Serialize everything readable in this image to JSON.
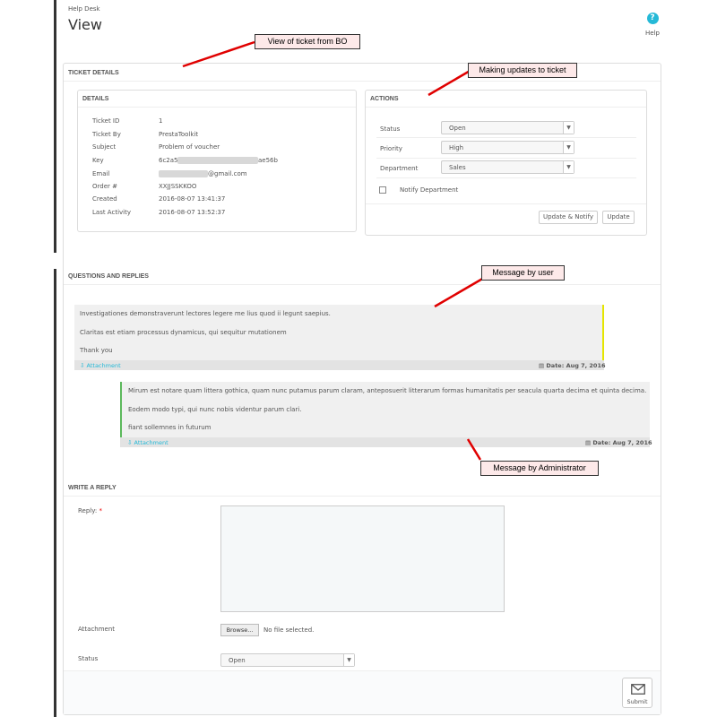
{
  "header": {
    "breadcrumb": "Help Desk",
    "title": "View",
    "help_label": "Help"
  },
  "ticket_details": {
    "heading": "TICKET DETAILS",
    "details": {
      "heading": "DETAILS",
      "rows": [
        {
          "label": "Ticket ID",
          "value": "1"
        },
        {
          "label": "Ticket By",
          "value": "PrestaToolkit"
        },
        {
          "label": "Subject",
          "value": "Problem of voucher"
        },
        {
          "label": "Key",
          "value_prefix": "6c2a5",
          "value_suffix": "ae56b"
        },
        {
          "label": "Email",
          "value_suffix": "@gmail.com"
        },
        {
          "label": "Order #",
          "value": "XXJJSSKKOO"
        },
        {
          "label": "Created",
          "value": "2016-08-07 13:41:37"
        },
        {
          "label": "Last Activity",
          "value": "2016-08-07 13:52:37"
        }
      ]
    },
    "actions": {
      "heading": "ACTIONS",
      "status_label": "Status",
      "status_value": "Open",
      "priority_label": "Priority",
      "priority_value": "High",
      "department_label": "Department",
      "department_value": "Sales",
      "notify_label": "Notify Department",
      "update_notify_label": "Update & Notify",
      "update_label": "Update"
    }
  },
  "questions": {
    "heading": "QUESTIONS AND REPLIES",
    "user_message": {
      "lines": [
        "Investigationes demonstraverunt lectores legere me lius quod ii legunt saepius.",
        "Claritas est etiam processus dynamicus, qui sequitur mutationem",
        "Thank you"
      ],
      "attachment_label": "Attachment",
      "date": "Date: Aug 7, 2016",
      "border_color": "#e5e500"
    },
    "admin_message": {
      "lines": [
        "Mirum est notare quam littera gothica, quam nunc putamus parum claram, anteposuerit litterarum formas humanitatis per seacula quarta decima et quinta decima.",
        "Eodem modo typi, qui nunc nobis videntur parum clari.",
        "fiant sollemnes in futurum"
      ],
      "attachment_label": "Attachment",
      "date": "Date: Aug 7, 2016",
      "border_color": "#5cb85c"
    }
  },
  "reply_form": {
    "heading": "WRITE A REPLY",
    "reply_label": "Reply:",
    "required_mark": "*",
    "attachment_label": "Attachment",
    "browse_label": "Browse...",
    "no_file_label": "No file selected.",
    "status_label": "Status",
    "status_value": "Open",
    "submit_label": "Submit"
  },
  "annotations": {
    "view_ticket": "View of ticket from BO",
    "making_updates": "Making updates to ticket",
    "message_user": "Message by user",
    "message_admin": "Message by Administrator"
  },
  "colors": {
    "accent": "#25b9d7",
    "annotation_arrow": "#e00000",
    "annotation_bg": "#fde9e9"
  }
}
